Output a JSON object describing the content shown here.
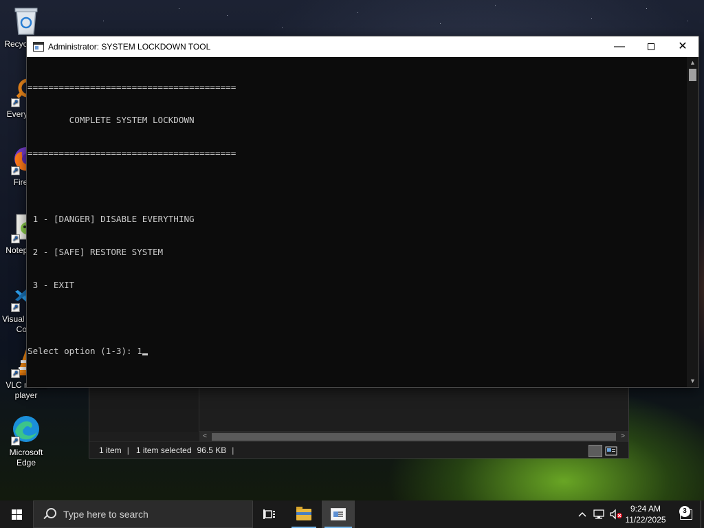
{
  "desktop": {
    "icons": [
      {
        "label": "Recycle Bin",
        "icon": "recycle-bin-icon"
      },
      {
        "label": "Everything",
        "icon": "everything-search-icon"
      },
      {
        "label": "Firefox",
        "icon": "firefox-icon"
      },
      {
        "label": "Notepad++",
        "icon": "notepad-plus-plus-icon"
      },
      {
        "label": "Visual Studio Code",
        "icon": "vscode-icon"
      },
      {
        "label": "VLC media player",
        "icon": "vlc-icon"
      },
      {
        "label": "Microsoft Edge",
        "icon": "edge-icon"
      }
    ]
  },
  "console": {
    "title": "Administrator:  SYSTEM LOCKDOWN TOOL",
    "lines": [
      "========================================",
      "        COMPLETE SYSTEM LOCKDOWN",
      "========================================",
      "",
      " 1 - [DANGER] DISABLE EVERYTHING",
      " 2 - [SAFE] RESTORE SYSTEM",
      " 3 - EXIT",
      ""
    ],
    "prompt": "Select option (1-3): ",
    "input_value": "1",
    "controls": {
      "minimize": "—",
      "close": "✕"
    }
  },
  "explorer": {
    "status": {
      "item_count": "1 item",
      "selection": "1 item selected",
      "size": "96.5 KB"
    }
  },
  "taskbar": {
    "search_placeholder": "Type here to search",
    "clock_time": "9:24 AM",
    "clock_date": "11/22/2025",
    "notification_count": "3"
  },
  "colors": {
    "console_bg": "#0c0c0c",
    "console_text": "#cccccc",
    "taskbar_bg": "#1a1a1a",
    "accent": "#76b9ed"
  }
}
